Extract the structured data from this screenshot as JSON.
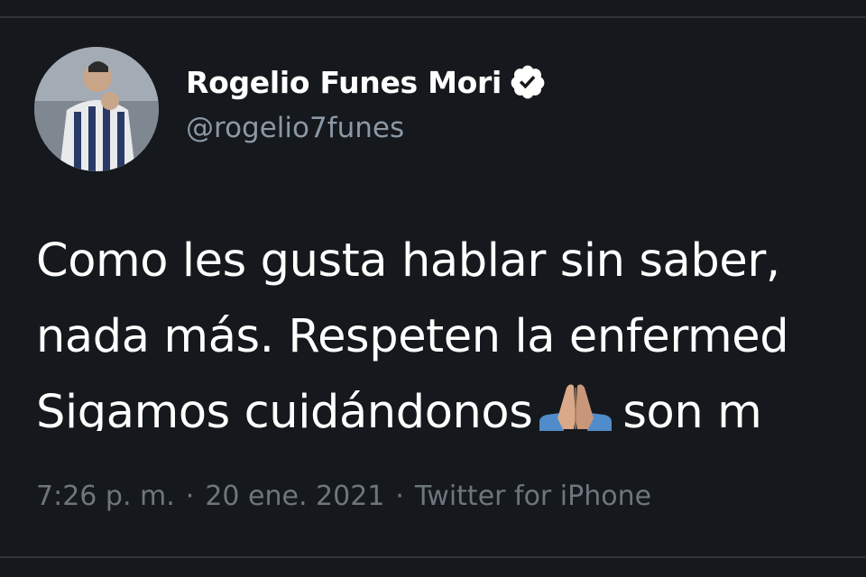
{
  "tweet": {
    "display_name": "Rogelio Funes Mori",
    "handle": "@rogelio7funes",
    "verified": true,
    "text_lines": [
      "Como les gusta hablar sin saber,",
      "nada más. Respeten la enfermed",
      "Sigamos cuidándonos",
      "son m"
    ],
    "emoji": "folded-hands",
    "time": "7:26 p. m.",
    "separator": "·",
    "date": "20 ene. 2021",
    "source": "Twitter for iPhone"
  },
  "colors": {
    "background": "#15181c",
    "text": "#ffffff",
    "secondary": "#8b98a5",
    "verified_badge": "#ffffff"
  },
  "icons": {
    "verified": "verified-badge-icon",
    "avatar": "profile-avatar"
  }
}
